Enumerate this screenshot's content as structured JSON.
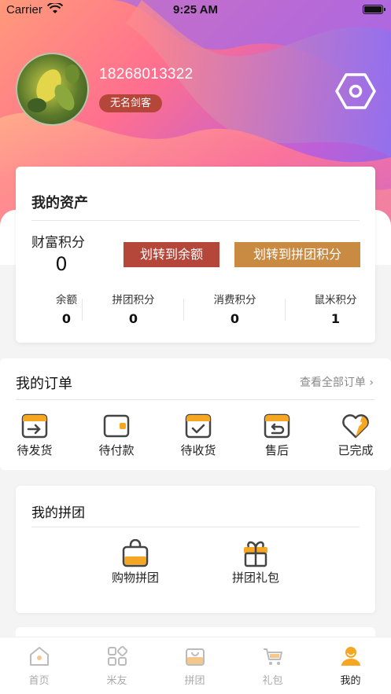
{
  "status_bar": {
    "carrier": "Carrier",
    "time": "9:25 AM"
  },
  "profile": {
    "phone": "18268013322",
    "nickname": "无名剑客"
  },
  "assets": {
    "title": "我的资产",
    "wealth_label": "财富积分",
    "wealth_value": "0",
    "btn_transfer_balance": "划转到余额",
    "btn_transfer_group": "划转到拼团积分",
    "stats": [
      {
        "label": "余额",
        "value": "0"
      },
      {
        "label": "拼团积分",
        "value": "0"
      },
      {
        "label": "消费积分",
        "value": "0"
      },
      {
        "label": "鼠米积分",
        "value": "1"
      }
    ]
  },
  "orders": {
    "title": "我的订单",
    "view_all": "查看全部订单 ›",
    "items": [
      {
        "label": "待发货",
        "icon": "pending-ship-icon"
      },
      {
        "label": "待付款",
        "icon": "wallet-icon"
      },
      {
        "label": "待收货",
        "icon": "check-box-icon"
      },
      {
        "label": "售后",
        "icon": "return-box-icon"
      },
      {
        "label": "已完成",
        "icon": "heart-check-icon"
      }
    ]
  },
  "group": {
    "title": "我的拼团",
    "items": [
      {
        "label": "购物拼团",
        "icon": "shopping-bag-icon"
      },
      {
        "label": "拼团礼包",
        "icon": "gift-icon"
      }
    ]
  },
  "tabbar": {
    "items": [
      {
        "label": "首页",
        "icon": "home-icon"
      },
      {
        "label": "米友",
        "icon": "grid-icon"
      },
      {
        "label": "拼团",
        "icon": "bag-icon"
      },
      {
        "label": "礼包",
        "icon": "cart-icon"
      },
      {
        "label": "我的",
        "icon": "user-icon"
      }
    ],
    "active": "我的"
  },
  "colors": {
    "primary_red": "#b5473a",
    "accent_gold": "#c98a42",
    "accent_orange": "#f5a623"
  }
}
